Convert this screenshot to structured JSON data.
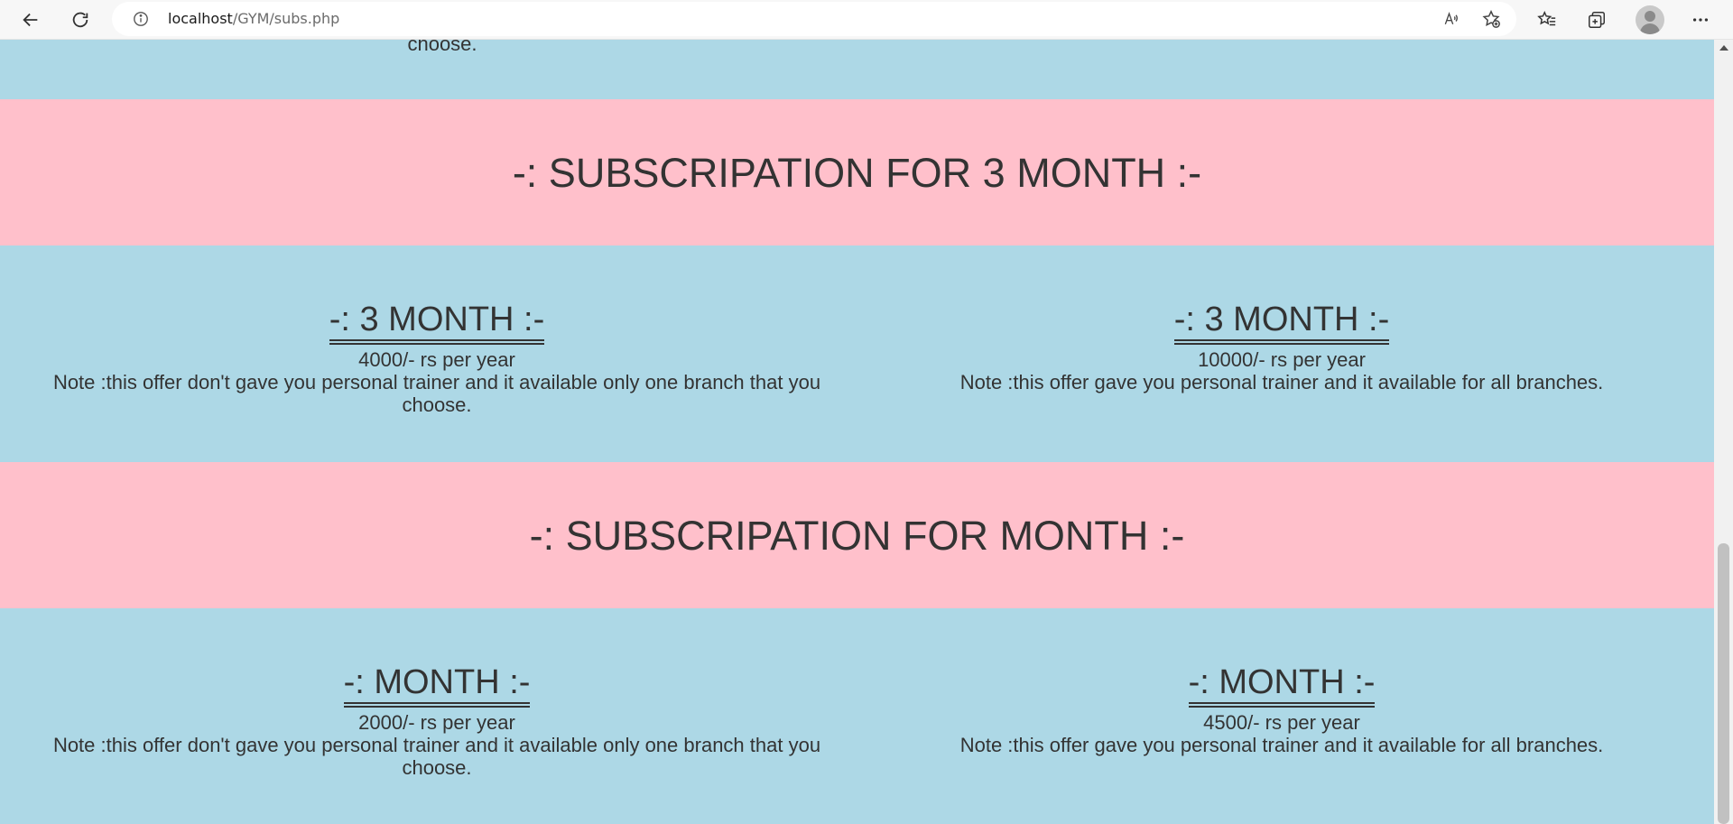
{
  "browser": {
    "url_host": "localhost",
    "url_path": "/GYM/subs.php",
    "icons": [
      "back-arrow-icon",
      "refresh-icon",
      "info-icon",
      "read-aloud-icon",
      "favorite-add-icon",
      "favorites-icon",
      "collections-icon",
      "profile-avatar",
      "more-icon"
    ]
  },
  "colors": {
    "blue_band": "#add8e6",
    "pink_band": "#ffc0cb",
    "text": "#333333"
  },
  "page": {
    "partial_top_text": "choose.",
    "sections": [
      {
        "title": "-: SUBSCRIPATION FOR 3 MONTH :-",
        "cards": [
          {
            "title": "-: 3 MONTH :-",
            "price": "4000/- rs per year",
            "note": "Note :this offer don't gave you personal trainer and it available only one branch that you choose."
          },
          {
            "title": "-: 3 MONTH :-",
            "price": "10000/- rs per year",
            "note": "Note :this offer gave you personal trainer and it available for all branches."
          }
        ]
      },
      {
        "title": "-: SUBSCRIPATION FOR MONTH :-",
        "cards": [
          {
            "title": "-: MONTH :-",
            "price": "2000/- rs per year",
            "note": "Note :this offer don't gave you personal trainer and it available only one branch that you choose."
          },
          {
            "title": "-: MONTH :-",
            "price": "4500/- rs per year",
            "note": "Note :this offer gave you personal trainer and it available for all branches."
          }
        ]
      }
    ]
  }
}
